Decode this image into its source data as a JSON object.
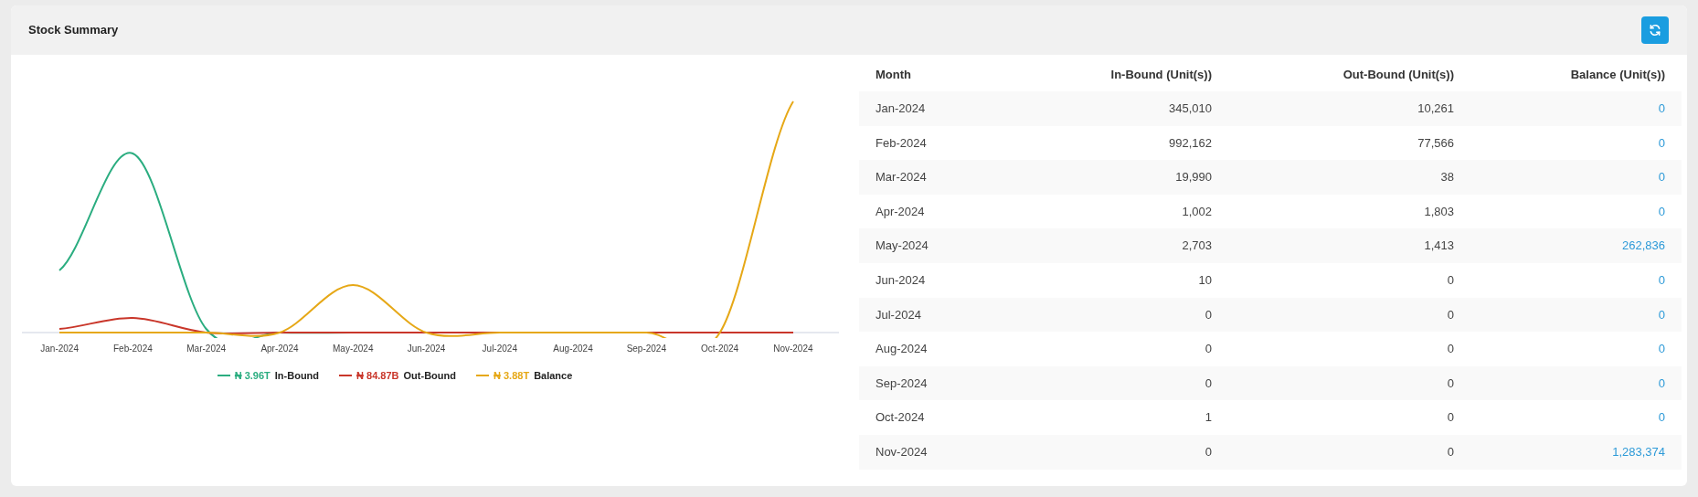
{
  "card": {
    "title": "Stock Summary"
  },
  "chart": {
    "x_labels": [
      "Jan-2024",
      "Feb-2024",
      "Mar-2024",
      "Apr-2024",
      "May-2024",
      "Jun-2024",
      "Jul-2024",
      "Aug-2024",
      "Sep-2024",
      "Oct-2024",
      "Nov-2024"
    ],
    "legend": [
      {
        "amount": "₦ 3.96T",
        "label": "In-Bound",
        "color": "#2bad80"
      },
      {
        "amount": "₦ 84.87B",
        "label": "Out-Bound",
        "color": "#c9362a"
      },
      {
        "amount": "₦ 3.88T",
        "label": "Balance",
        "color": "#e6a817"
      }
    ]
  },
  "table": {
    "columns": [
      "Month",
      "In-Bound (Unit(s))",
      "Out-Bound (Unit(s))",
      "Balance (Unit(s))"
    ],
    "rows": [
      [
        "Jan-2024",
        "345,010",
        "10,261",
        "0"
      ],
      [
        "Feb-2024",
        "992,162",
        "77,566",
        "0"
      ],
      [
        "Mar-2024",
        "19,990",
        "38",
        "0"
      ],
      [
        "Apr-2024",
        "1,002",
        "1,803",
        "0"
      ],
      [
        "May-2024",
        "2,703",
        "1,413",
        "262,836"
      ],
      [
        "Jun-2024",
        "10",
        "0",
        "0"
      ],
      [
        "Jul-2024",
        "0",
        "0",
        "0"
      ],
      [
        "Aug-2024",
        "0",
        "0",
        "0"
      ],
      [
        "Sep-2024",
        "0",
        "0",
        "0"
      ],
      [
        "Oct-2024",
        "1",
        "0",
        "0"
      ],
      [
        "Nov-2024",
        "0",
        "0",
        "1,283,374"
      ]
    ]
  }
}
